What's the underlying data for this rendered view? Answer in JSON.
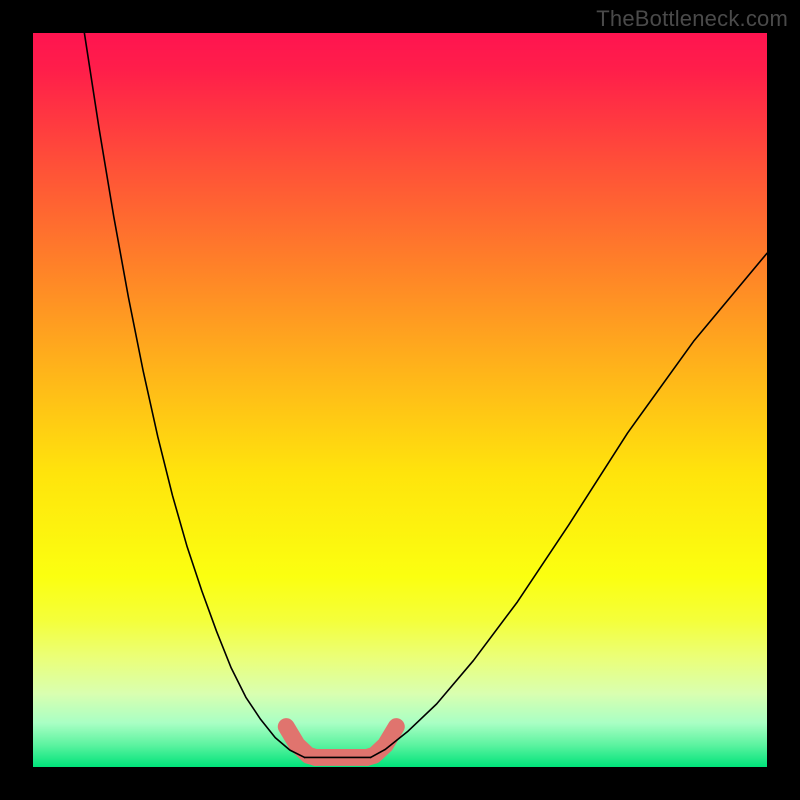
{
  "watermark": "TheBottleneck.com",
  "chart_data": {
    "type": "line",
    "title": "",
    "xlabel": "",
    "ylabel": "",
    "xlim": [
      0,
      100
    ],
    "ylim": [
      0,
      100
    ],
    "grid": false,
    "legend": false,
    "background_gradient": {
      "top_color": "#ff1450",
      "mid_color": "#ffe400",
      "bottom_color": "#00e37a",
      "stops": [
        {
          "pos": 0.0,
          "color": "#ff1450"
        },
        {
          "pos": 0.05,
          "color": "#ff1e4a"
        },
        {
          "pos": 0.18,
          "color": "#ff5038"
        },
        {
          "pos": 0.32,
          "color": "#ff8228"
        },
        {
          "pos": 0.46,
          "color": "#ffb41a"
        },
        {
          "pos": 0.6,
          "color": "#ffe40c"
        },
        {
          "pos": 0.74,
          "color": "#fbff10"
        },
        {
          "pos": 0.8,
          "color": "#f4ff3a"
        },
        {
          "pos": 0.85,
          "color": "#ebff77"
        },
        {
          "pos": 0.9,
          "color": "#d9ffb0"
        },
        {
          "pos": 0.94,
          "color": "#a9ffc4"
        },
        {
          "pos": 0.97,
          "color": "#5cf3a0"
        },
        {
          "pos": 1.0,
          "color": "#00e37a"
        }
      ]
    },
    "series": [
      {
        "name": "left-branch",
        "color": "#000000",
        "width": 1.6,
        "x": [
          7,
          9,
          11,
          13,
          15,
          17,
          19,
          21,
          23,
          25,
          27,
          29,
          31,
          33,
          35,
          37
        ],
        "y": [
          100,
          87,
          75,
          64,
          54,
          45,
          37,
          30,
          24,
          18.5,
          13.5,
          9.5,
          6.5,
          4.0,
          2.3,
          1.3
        ]
      },
      {
        "name": "right-branch",
        "color": "#000000",
        "width": 1.6,
        "x": [
          46,
          48,
          51,
          55,
          60,
          66,
          73,
          81,
          90,
          100
        ],
        "y": [
          1.3,
          2.4,
          4.8,
          8.6,
          14.5,
          22.5,
          33.0,
          45.5,
          58.0,
          70.0
        ]
      },
      {
        "name": "floor",
        "color": "#000000",
        "width": 1.6,
        "x": [
          37,
          46
        ],
        "y": [
          1.3,
          1.3
        ]
      }
    ],
    "highlight_band": {
      "color": "#e0746e",
      "alpha": 1.0,
      "thickness_pct": 2.3,
      "segments": [
        {
          "x": [
            34.5,
            36.0,
            37.5,
            38.5
          ],
          "y": [
            5.5,
            3.0,
            1.6,
            1.3
          ]
        },
        {
          "x": [
            38.5,
            45.5
          ],
          "y": [
            1.3,
            1.3
          ]
        },
        {
          "x": [
            45.5,
            46.5,
            48.0,
            49.5
          ],
          "y": [
            1.3,
            1.6,
            3.0,
            5.5
          ]
        }
      ]
    }
  }
}
